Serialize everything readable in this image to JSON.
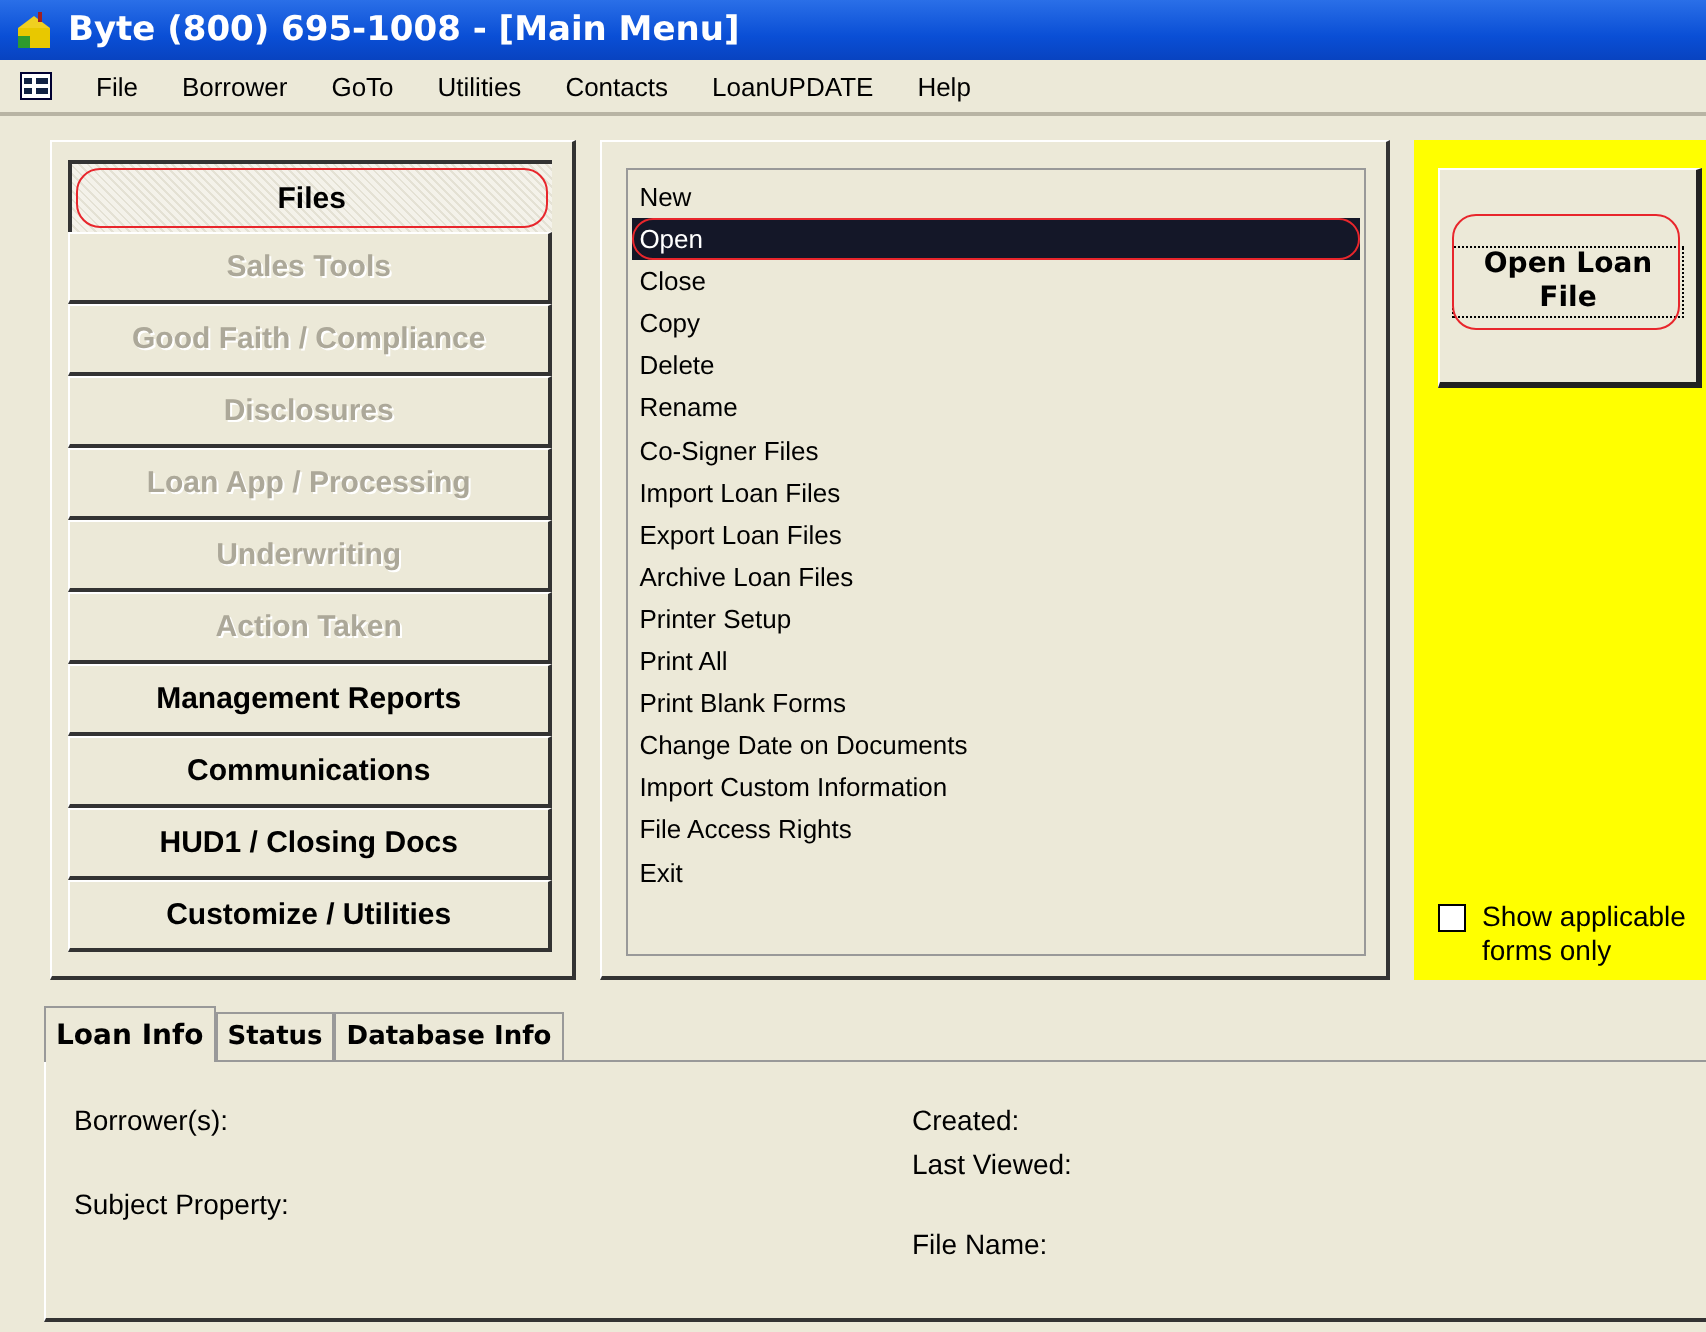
{
  "window": {
    "title": "Byte (800) 695-1008 - [Main Menu]"
  },
  "menu_bar": [
    "File",
    "Borrower",
    "GoTo",
    "Utilities",
    "Contacts",
    "LoanUPDATE",
    "Help"
  ],
  "sections": [
    {
      "label": "Files",
      "selected": true,
      "disabled": false,
      "circled": true
    },
    {
      "label": "Sales Tools",
      "selected": false,
      "disabled": true,
      "circled": false
    },
    {
      "label": "Good Faith / Compliance",
      "selected": false,
      "disabled": true,
      "circled": false
    },
    {
      "label": "Disclosures",
      "selected": false,
      "disabled": true,
      "circled": false
    },
    {
      "label": "Loan App / Processing",
      "selected": false,
      "disabled": true,
      "circled": false
    },
    {
      "label": "Underwriting",
      "selected": false,
      "disabled": true,
      "circled": false
    },
    {
      "label": "Action Taken",
      "selected": false,
      "disabled": true,
      "circled": false
    },
    {
      "label": "Management Reports",
      "selected": false,
      "disabled": false,
      "circled": false
    },
    {
      "label": "Communications",
      "selected": false,
      "disabled": false,
      "circled": false
    },
    {
      "label": "HUD1 / Closing Docs",
      "selected": false,
      "disabled": false,
      "circled": false
    },
    {
      "label": "Customize / Utilities",
      "selected": false,
      "disabled": false,
      "circled": false
    }
  ],
  "commands": [
    {
      "label": "New",
      "selected": false,
      "circled": false
    },
    {
      "label": "Open",
      "selected": true,
      "circled": true
    },
    {
      "label": "Close",
      "selected": false,
      "circled": false
    },
    {
      "label": "Copy",
      "selected": false,
      "circled": false
    },
    {
      "label": "Delete",
      "selected": false,
      "circled": false
    },
    {
      "label": "Rename",
      "selected": false,
      "circled": false
    },
    {
      "label": "Co-Signer Files",
      "selected": false,
      "circled": false
    },
    {
      "label": "Import Loan Files",
      "selected": false,
      "circled": false
    },
    {
      "label": "Export Loan Files",
      "selected": false,
      "circled": false
    },
    {
      "label": "Archive Loan Files",
      "selected": false,
      "circled": false
    },
    {
      "label": "Printer Setup",
      "selected": false,
      "circled": false
    },
    {
      "label": "Print All",
      "selected": false,
      "circled": false
    },
    {
      "label": "Print Blank Forms",
      "selected": false,
      "circled": false
    },
    {
      "label": "Change Date on Documents",
      "selected": false,
      "circled": false
    },
    {
      "label": "Import Custom Information",
      "selected": false,
      "circled": false
    },
    {
      "label": "File Access Rights",
      "selected": false,
      "circled": false
    },
    {
      "label": "Exit",
      "selected": false,
      "circled": false
    }
  ],
  "action_button": {
    "label": "Open Loan File",
    "circled": true
  },
  "show_applicable": {
    "label": "Show applicable forms only",
    "checked": false
  },
  "info_tabs": [
    {
      "label": "Loan Info",
      "selected": true
    },
    {
      "label": "Status",
      "selected": false
    },
    {
      "label": "Database Info",
      "selected": false
    }
  ],
  "info_left": [
    "Borrower(s):",
    "Subject Property:"
  ],
  "info_right": [
    "Created:",
    "Last Viewed:",
    "File Name:"
  ]
}
